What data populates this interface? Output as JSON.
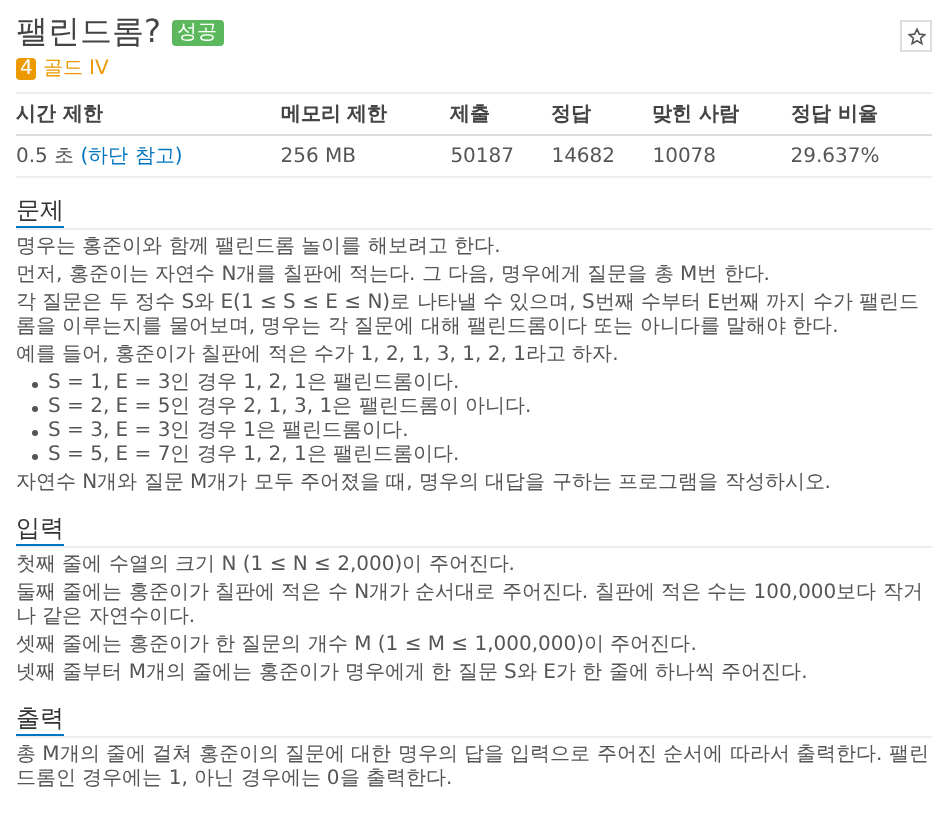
{
  "problem": {
    "title": "팰린드롬?",
    "status_badge": "성공",
    "tier": {
      "level": "4",
      "name": "골드 IV"
    }
  },
  "info_table": {
    "columns": [
      "시간 제한",
      "메모리 제한",
      "제출",
      "정답",
      "맞힌 사람",
      "정답 비율"
    ],
    "cells": [
      {
        "text": "0.5 초",
        "link": "(하단 참고)"
      },
      {
        "text": "256 MB"
      },
      {
        "text": "50187"
      },
      {
        "text": "14682"
      },
      {
        "text": "10078"
      },
      {
        "text": "29.637%"
      }
    ]
  },
  "sections": [
    {
      "heading": "문제",
      "blocks": [
        {
          "kind": "p",
          "text": "명우는 홍준이와 함께 팰린드롬 놀이를 해보려고 한다."
        },
        {
          "kind": "p",
          "text": "먼저, 홍준이는 자연수 N개를 칠판에 적는다. 그 다음, 명우에게 질문을 총 M번 한다."
        },
        {
          "kind": "p",
          "text": "각 질문은 두 정수 S와 E(1 ≤ S ≤ E ≤ N)로 나타낼 수 있으며, S번째 수부터 E번째 까지 수가 팰린드롬을 이루는지를 물어보며, 명우는 각 질문에 대해 팰린드롬이다 또는 아니다를 말해야 한다."
        },
        {
          "kind": "p",
          "text": "예를 들어, 홍준이가 칠판에 적은 수가 1, 2, 1, 3, 1, 2, 1라고 하자."
        },
        {
          "kind": "list",
          "items": [
            "S = 1, E = 3인 경우 1, 2, 1은 팰린드롬이다.",
            "S = 2, E = 5인 경우 2, 1, 3, 1은 팰린드롬이 아니다.",
            "S = 3, E = 3인 경우 1은 팰린드롬이다.",
            "S = 5, E = 7인 경우 1, 2, 1은 팰린드롬이다."
          ]
        },
        {
          "kind": "p",
          "text": "자연수 N개와 질문 M개가 모두 주어졌을 때, 명우의 대답을 구하는 프로그램을 작성하시오."
        }
      ]
    },
    {
      "heading": "입력",
      "blocks": [
        {
          "kind": "p",
          "text": "첫째 줄에 수열의 크기 N (1 ≤ N ≤ 2,000)이 주어진다."
        },
        {
          "kind": "p",
          "text": "둘째 줄에는 홍준이가 칠판에 적은 수 N개가 순서대로 주어진다. 칠판에 적은 수는 100,000보다 작거나 같은 자연수이다."
        },
        {
          "kind": "p",
          "text": "셋째 줄에는 홍준이가 한 질문의 개수 M (1 ≤ M ≤ 1,000,000)이 주어진다."
        },
        {
          "kind": "p",
          "text": "넷째 줄부터 M개의 줄에는 홍준이가 명우에게 한 질문 S와 E가 한 줄에 하나씩 주어진다."
        }
      ]
    },
    {
      "heading": "출력",
      "blocks": [
        {
          "kind": "p",
          "text": "총 M개의 줄에 걸쳐 홍준이의 질문에 대한 명우의 답을 입력으로 주어진 순서에 따라서 출력한다. 팰린드롬인 경우에는 1, 아닌 경우에는 0을 출력한다."
        }
      ]
    }
  ]
}
